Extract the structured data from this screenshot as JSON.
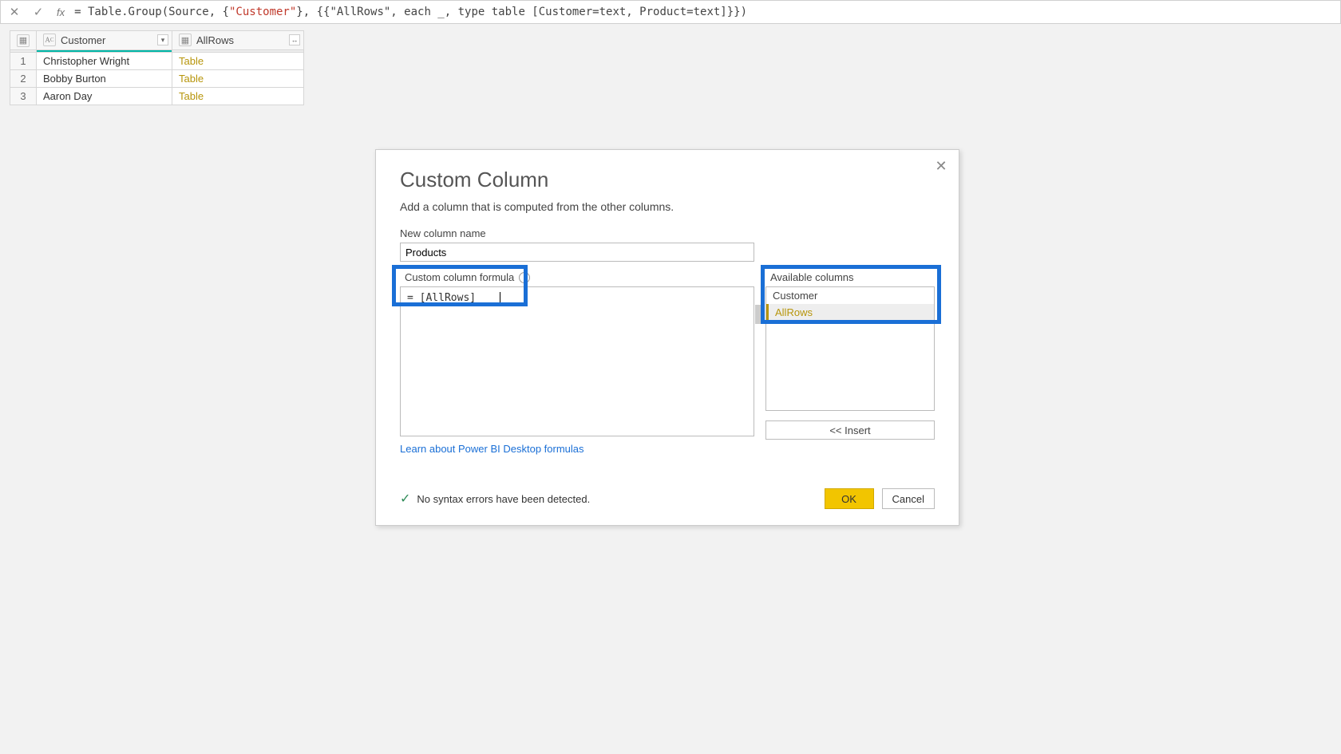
{
  "formula_bar": {
    "fx_label": "fx",
    "prefix": "= ",
    "fn": "Table.Group",
    "open": "(Source, {",
    "arg1": "\"Customer\"",
    "mid": "}, {{\"AllRows\", each _, type table [Customer=text, Product=text]}})"
  },
  "table": {
    "columns": {
      "c1": "Customer",
      "c2": "AllRows"
    },
    "rows": [
      {
        "n": "1",
        "customer": "Christopher Wright",
        "allrows": "Table"
      },
      {
        "n": "2",
        "customer": "Bobby Burton",
        "allrows": "Table"
      },
      {
        "n": "3",
        "customer": "Aaron Day",
        "allrows": "Table"
      }
    ]
  },
  "dialog": {
    "title": "Custom Column",
    "subtitle": "Add a column that is computed from the other columns.",
    "new_col_label": "New column name",
    "new_col_value": "Products",
    "formula_label": "Custom column formula",
    "formula_value": "= [AllRows]",
    "avail_label": "Available columns",
    "avail": {
      "c1": "Customer",
      "c2": "AllRows"
    },
    "insert_label": "<< Insert",
    "learn_link": "Learn about Power BI Desktop formulas",
    "status": "No syntax errors have been detected.",
    "ok": "OK",
    "cancel": "Cancel"
  }
}
